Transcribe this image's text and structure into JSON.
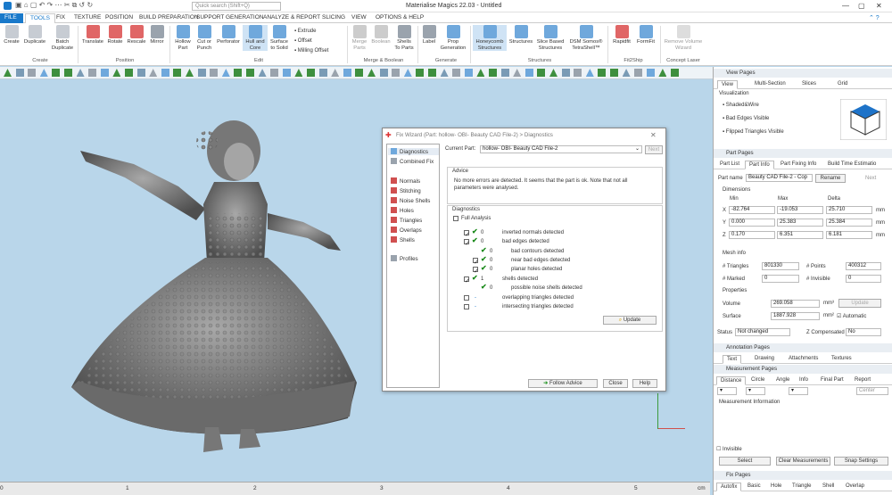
{
  "window": {
    "title": "Materialise Magics 22.03 - Untitled",
    "search_placeholder": "Quick search (Shift+Q)"
  },
  "menu": [
    "FILE",
    "TOOLS",
    "FIX",
    "TEXTURE",
    "POSITION",
    "BUILD PREPARATION",
    "SUPPORT GENERATION",
    "ANALYZE & REPORT",
    "SLICING",
    "VIEW",
    "OPTIONS & HELP"
  ],
  "ribbon": {
    "create": {
      "group": "Create",
      "items": [
        "Create",
        "Duplicate",
        "Batch\nDuplicate"
      ]
    },
    "position": {
      "group": "Position",
      "items": [
        "Translate",
        "Rotate",
        "Rescale",
        "Mirror"
      ]
    },
    "edit": {
      "group": "Edit",
      "items": [
        "Hollow\nPart",
        "Cut or\nPunch",
        "Perforator",
        "Hull and\nCore",
        "Surface\nto Solid"
      ],
      "small": [
        "Extrude",
        "Offset",
        "Milling Offset"
      ]
    },
    "merge": {
      "group": "Merge & Boolean",
      "items": [
        "Merge\nParts",
        "Boolean",
        "Shells\nTo Parts"
      ]
    },
    "generate": {
      "group": "Generate",
      "items": [
        "Label",
        "Prop\nGeneration"
      ]
    },
    "structures": {
      "group": "Structures",
      "items": [
        "Honeycomb\nStructures",
        "Structures",
        "Slice Based\nStructures",
        "DSM Somos®\nTetraShell™"
      ]
    },
    "fit2ship": {
      "group": "Fit2Ship",
      "items": [
        "Rapidfit",
        "FormFit"
      ]
    },
    "concept": {
      "group": "Concept Laser",
      "items": [
        "Remove Volume\nWizard"
      ]
    }
  },
  "ruler": [
    "0",
    "1",
    "2",
    "3",
    "4",
    "5",
    "cm"
  ],
  "right_panel": {
    "view_pages": {
      "header": "View Pages",
      "tabs": [
        "View",
        "Multi-Section",
        "Slices",
        "Grid"
      ],
      "visualization": "Visualization",
      "options": [
        "Shaded&Wire",
        "Bad Edges Visible",
        "Flipped Triangles Visible"
      ]
    },
    "part_pages": {
      "header": "Part Pages",
      "tabs": [
        "Part List",
        "Part Info",
        "Part Fixing Info",
        "Build Time Estimatio"
      ],
      "part_name_label": "Part name",
      "part_name": "Beauty CAD File-2 - Cop",
      "rename": "Rename",
      "next": "Next",
      "dimensions": "Dimensions",
      "cols": [
        "Min",
        "Max",
        "Delta"
      ],
      "rows": [
        {
          "axis": "X",
          "min": "-82.764",
          "max": "-19.053",
          "delta": "25.710",
          "unit": "mm"
        },
        {
          "axis": "Y",
          "min": "0.000",
          "max": "25.383",
          "delta": "25.384",
          "unit": "mm"
        },
        {
          "axis": "Z",
          "min": "0.170",
          "max": "6.351",
          "delta": "6.181",
          "unit": "mm"
        }
      ],
      "mesh_info": "Mesh info",
      "triangles_label": "# Triangles",
      "triangles": "801330",
      "points_label": "# Points",
      "points": "400312",
      "marked_label": "# Marked",
      "marked": "0",
      "invisible_label": "# Invisible",
      "invisible": "0",
      "properties": "Properties",
      "volume_label": "Volume",
      "volume": "269.058",
      "vol_unit": "mm³",
      "update": "Update",
      "surface_label": "Surface",
      "surface": "1887.928",
      "surf_unit": "mm²",
      "automatic": "Automatic",
      "status_label": "Status",
      "status": "Not changed",
      "zcomp_label": "Z Compensated",
      "zcomp": "No"
    },
    "annotation_pages": {
      "header": "Annotation Pages",
      "tabs": [
        "Text",
        "Drawing",
        "Attachments",
        "Textures"
      ]
    },
    "measurement_pages": {
      "header": "Measurement Pages",
      "tabs": [
        "Distance",
        "Circle",
        "Angle",
        "Info",
        "Final Part",
        "Report"
      ],
      "center": "Center",
      "info": "Measurement Information",
      "invisible": "Invisible",
      "buttons": [
        "Select",
        "Clear Measurements",
        "Snap Settings"
      ]
    },
    "fix_pages": {
      "header": "Fix Pages",
      "tabs": [
        "Autofix",
        "Basic",
        "Hole",
        "Triangle",
        "Shell",
        "Overlap"
      ]
    }
  },
  "dialog": {
    "title": "Fix Wizard (Part: hollow- OBI- Beauty CAD File-2) > Diagnostics",
    "side": [
      "Diagnostics",
      "Combined Fix",
      "Normals",
      "Stitching",
      "Noise Shells",
      "Holes",
      "Triangles",
      "Overlaps",
      "Shells",
      "Profiles"
    ],
    "current_part_label": "Current Part:",
    "current_part": "hollow- OBI- Beauty CAD File-2",
    "next": "Next",
    "advice_label": "Advice",
    "advice": "No more errors are detected. It seems that the part is ok. Note that not all parameters were analysed.",
    "diag_label": "Diagnostics",
    "full_analysis": "Full Analysis",
    "rows": [
      {
        "v": "0",
        "t": "inverted normals detected"
      },
      {
        "v": "0",
        "t": "bad edges detected"
      },
      {
        "v": "0",
        "t": "bad contours detected"
      },
      {
        "v": "0",
        "t": "near bad edges detected"
      },
      {
        "v": "0",
        "t": "planar holes detected"
      },
      {
        "v": "1",
        "t": "shells detected"
      },
      {
        "v": "0",
        "t": "possible noise shells detected"
      },
      {
        "v": "-",
        "t": "overlapping triangles detected"
      },
      {
        "v": "-",
        "t": "intersecting triangles detected"
      }
    ],
    "update": "Update",
    "follow": "Follow Advice",
    "close": "Close",
    "help": "Help"
  }
}
